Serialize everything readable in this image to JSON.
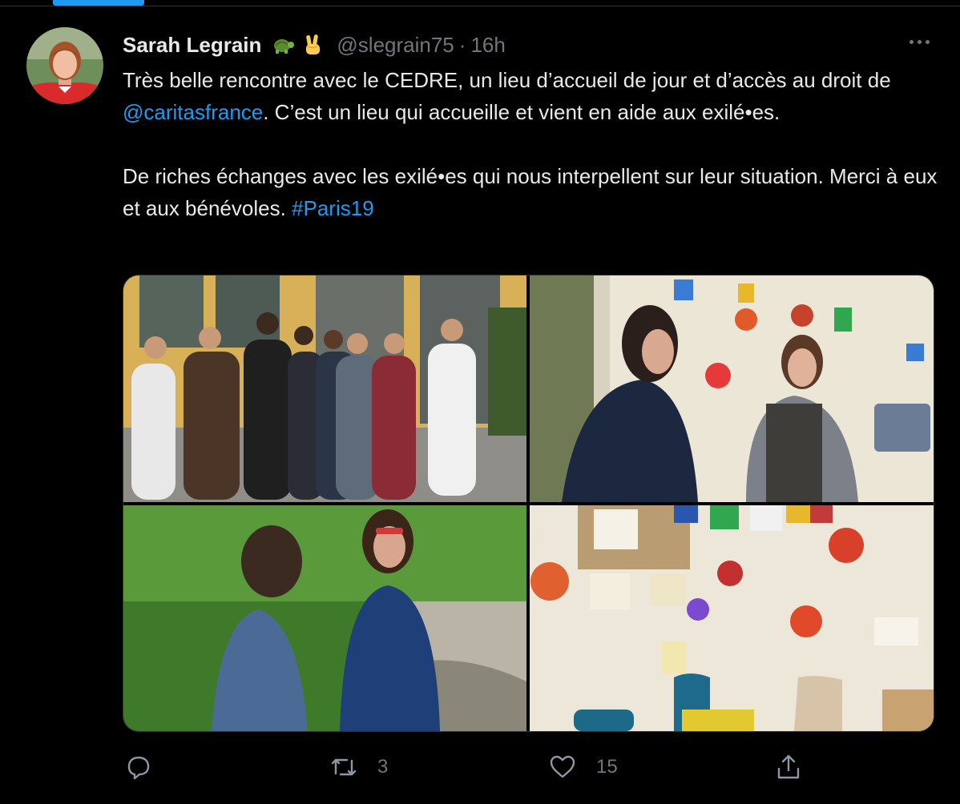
{
  "author": {
    "name": "Sarah Legrain",
    "badges": [
      "turtle-emoji",
      "victory-hand-emoji"
    ],
    "handle": "@slegrain75",
    "separator": "·",
    "time": "16h"
  },
  "tweet": {
    "p1_before": "Très belle rencontre avec le CEDRE, un lieu d’accueil de jour et d’accès au droit de ",
    "mention": "@caritasfrance",
    "p1_after": ". C’est un lieu qui accueille et vient en aide aux exilé•es.",
    "p2_before": "De riches échanges avec les exilé•es qui nous interpellent sur leur situation. Merci à eux et aux bénévoles. ",
    "hashtag": "#Paris19"
  },
  "media": {
    "photos": [
      {
        "name": "group-photo-outside-building"
      },
      {
        "name": "photo-two-women-talking-indoors"
      },
      {
        "name": "photo-two-women-in-garden"
      },
      {
        "name": "photo-decorated-room-with-chairs"
      }
    ]
  },
  "actions": {
    "reply": {
      "icon": "reply-icon",
      "count": ""
    },
    "retweet": {
      "icon": "retweet-icon",
      "count": "3"
    },
    "like": {
      "icon": "heart-icon",
      "count": "15"
    },
    "share": {
      "icon": "share-icon",
      "count": ""
    }
  },
  "colors": {
    "background": "#000000",
    "text": "#e7e9ea",
    "muted": "#71767b",
    "accent": "#1d9bf0"
  }
}
